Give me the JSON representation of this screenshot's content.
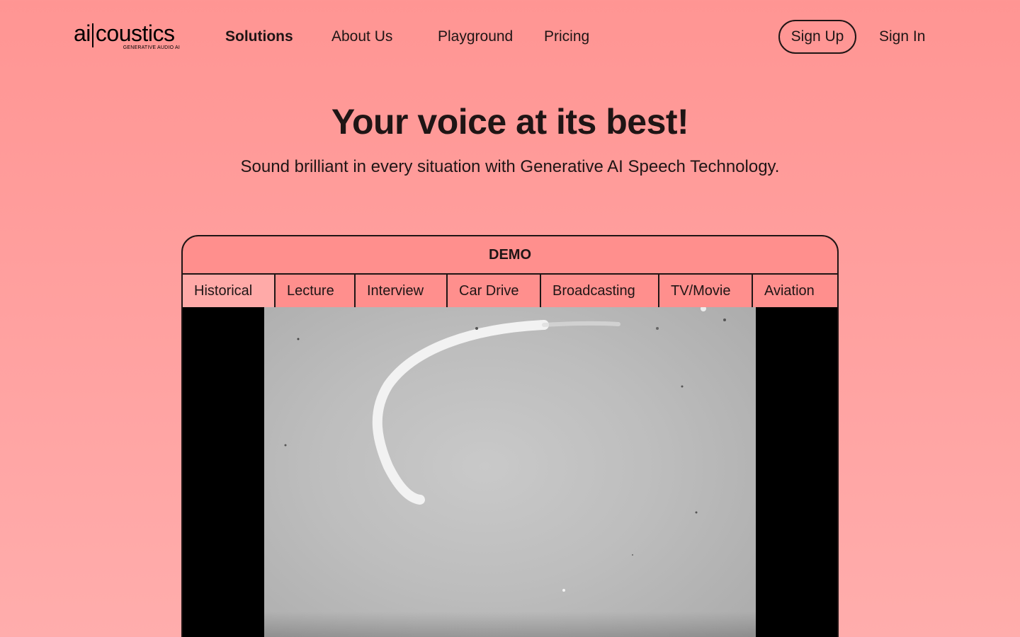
{
  "logo": {
    "main_left": "ai",
    "main_right": "coustics",
    "tagline": "GENERATIVE AUDIO AI"
  },
  "nav": {
    "links": [
      "Solutions",
      "About Us",
      "Playground",
      "Pricing"
    ],
    "sign_up": "Sign Up",
    "sign_in": "Sign In"
  },
  "hero": {
    "title": "Your voice at its best!",
    "subtitle": "Sound brilliant in every situation with Generative AI Speech Technology."
  },
  "demo": {
    "header": "DEMO",
    "tabs": [
      "Historical",
      "Lecture",
      "Interview",
      "Car Drive",
      "Broadcasting",
      "TV/Movie",
      "Aviation"
    ],
    "active_tab": "Historical"
  },
  "colors": {
    "background": "#ff9593",
    "text": "#1f1515",
    "active_tab": "#ffaaa8"
  }
}
